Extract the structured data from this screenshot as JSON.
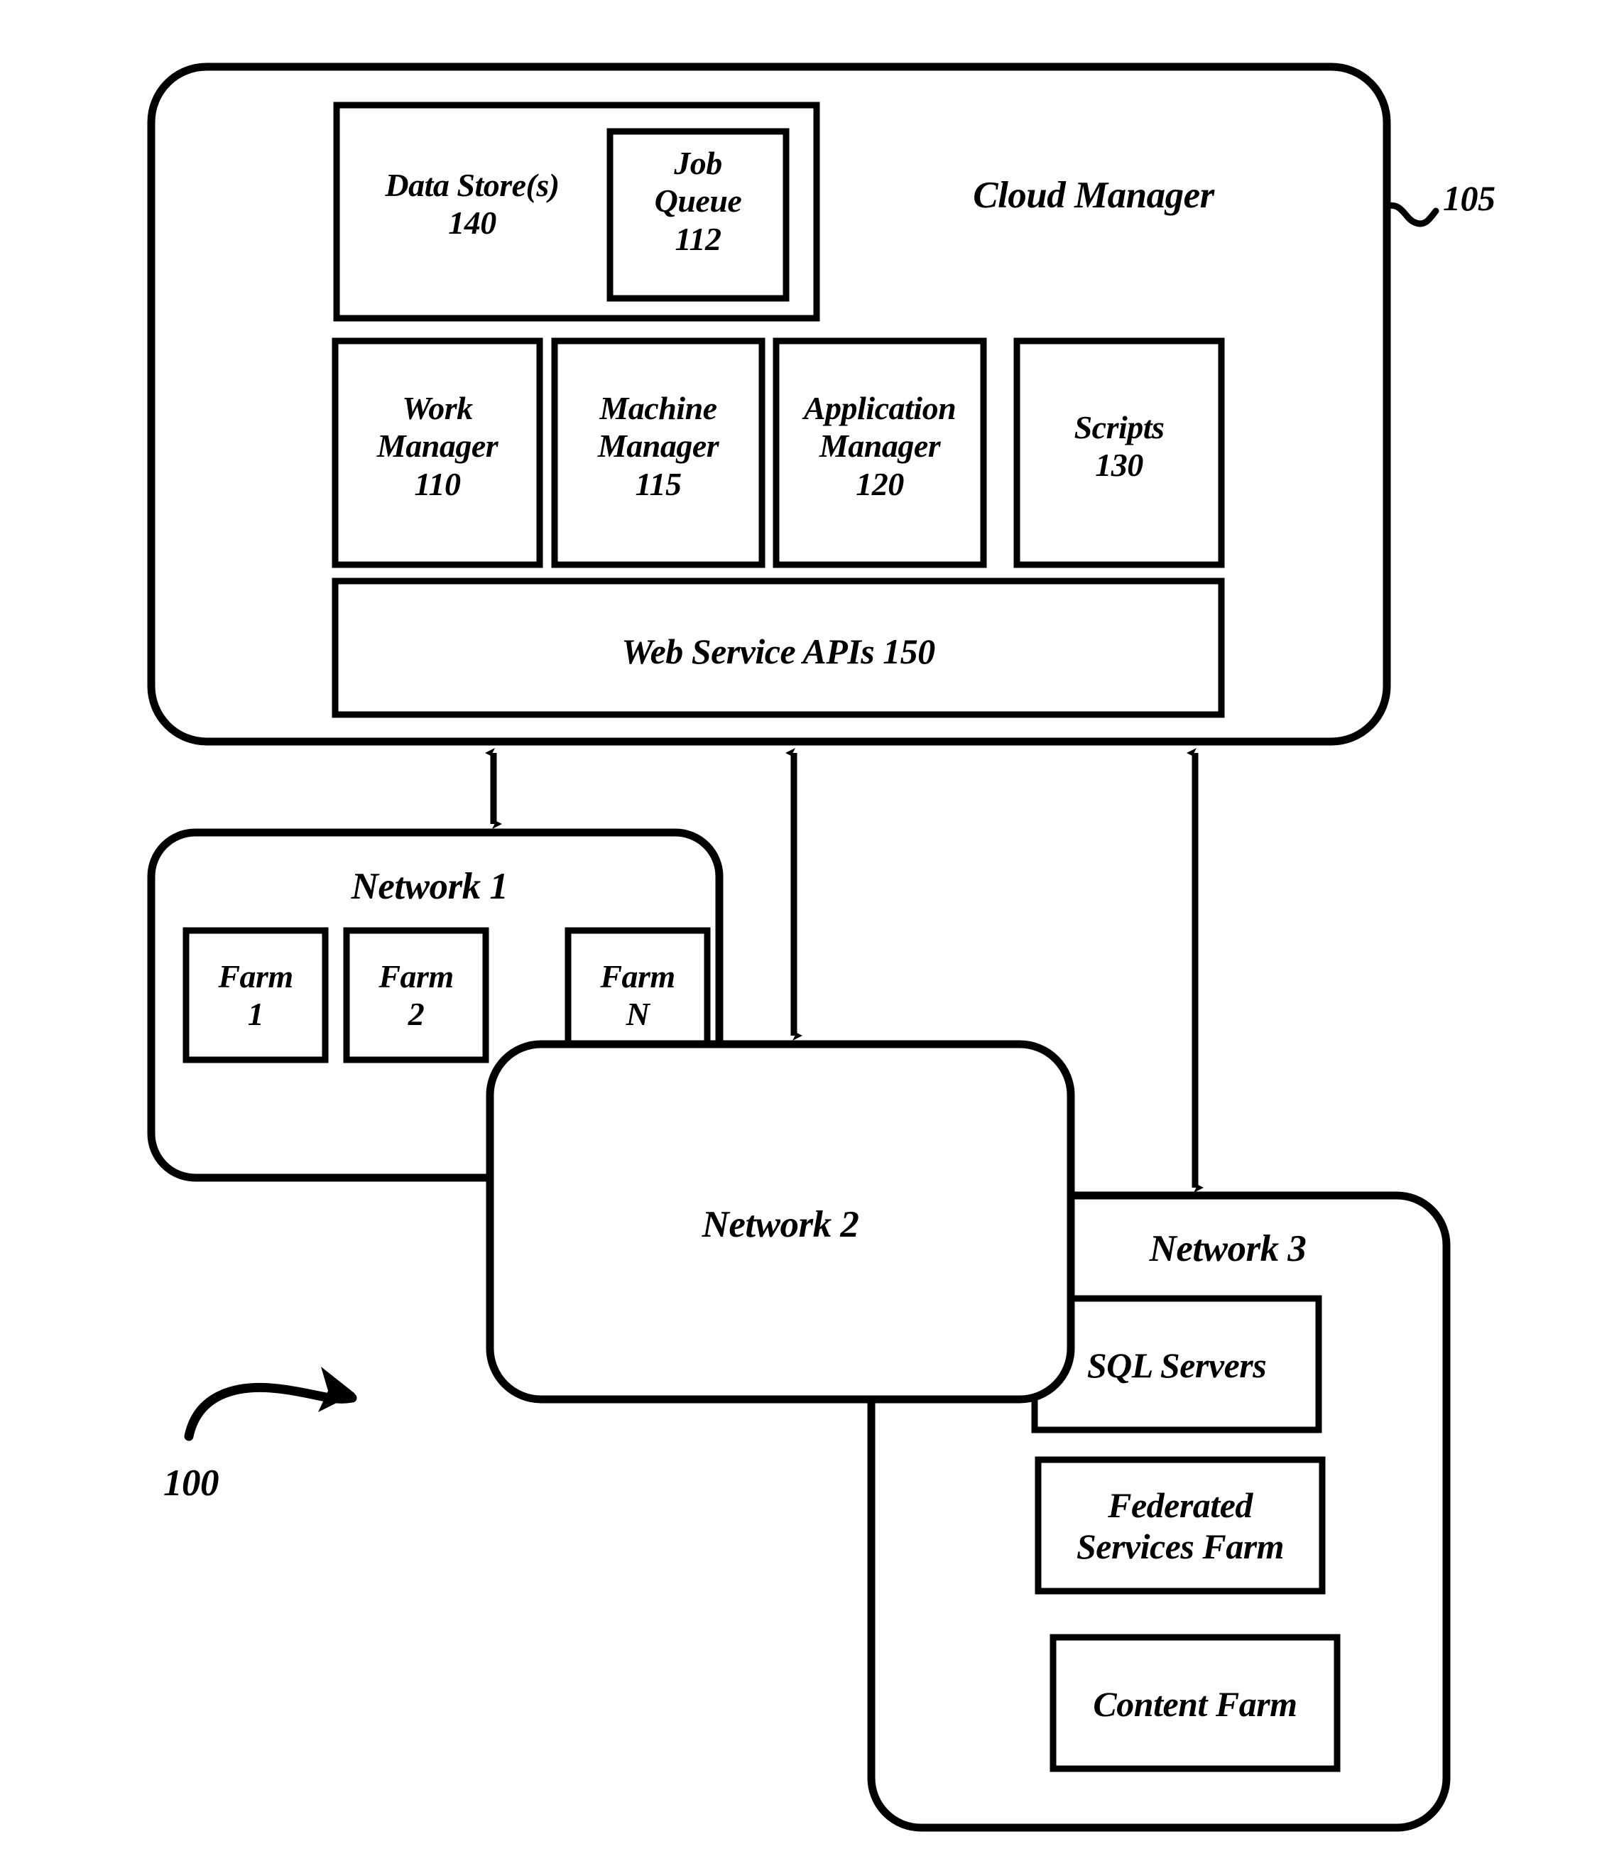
{
  "figure": {
    "type": "patent-block-diagram",
    "background_color": "#ffffff",
    "line_color": "#000000",
    "reference_numeral_overall": "100",
    "reference_numeral_cloud_manager": "105"
  },
  "cloud_manager": {
    "title": "Cloud Manager",
    "ref": "105",
    "data_store": {
      "label": "Data Store(s)\n140"
    },
    "job_queue": {
      "label": "Job\nQueue\n112"
    },
    "modules": [
      {
        "label": "Work\nManager\n110"
      },
      {
        "label": "Machine\nManager\n115"
      },
      {
        "label": "Application\nManager\n120"
      },
      {
        "label": "Scripts\n130"
      }
    ],
    "web_service_apis": {
      "label": "Web Service APIs 150"
    }
  },
  "network1": {
    "title": "Network 1",
    "farms": [
      {
        "label": "Farm\n1"
      },
      {
        "label": "Farm\n2"
      },
      {
        "label": "Farm\nN"
      }
    ]
  },
  "network2": {
    "title": "Network 2"
  },
  "network3": {
    "title": "Network 3",
    "items": [
      {
        "label": "SQL Servers"
      },
      {
        "label": "Federated\nServices Farm"
      },
      {
        "label": "Content Farm"
      }
    ]
  },
  "callout": {
    "overall_ref": "100"
  }
}
